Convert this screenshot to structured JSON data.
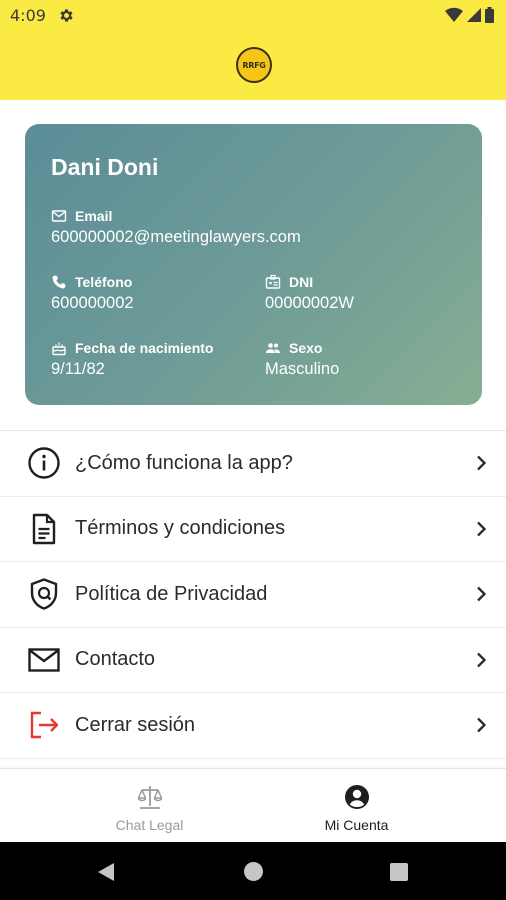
{
  "status_bar": {
    "time": "4:09"
  },
  "header": {
    "logo_text": "RRFG",
    "background_color": "#FBEA44"
  },
  "profile": {
    "name": "Dani Doni",
    "email_label": "Email",
    "email": "600000002@meetinglawyers.com",
    "phone_label": "Teléfono",
    "phone": "600000002",
    "dni_label": "DNI",
    "dni": "00000002W",
    "birth_label": "Fecha de nacimiento",
    "birth": "9/11/82",
    "sex_label": "Sexo",
    "sex": "Masculino"
  },
  "menu": [
    {
      "label": "¿Cómo funciona la app?",
      "icon": "info-icon"
    },
    {
      "label": "Términos y condiciones",
      "icon": "document-icon"
    },
    {
      "label": "Política de Privacidad",
      "icon": "shield-icon"
    },
    {
      "label": "Contacto",
      "icon": "mail-icon"
    },
    {
      "label": "Cerrar sesión",
      "icon": "logout-icon",
      "color": "#E53935"
    }
  ],
  "bottom_nav": {
    "tabs": [
      {
        "label": "Chat Legal",
        "icon": "scale-icon",
        "active": false
      },
      {
        "label": "Mi Cuenta",
        "icon": "account-circle-icon",
        "active": true
      }
    ]
  },
  "colors": {
    "card_gradient_start": "#5B8D98",
    "card_gradient_end": "#87AE92",
    "logout_red": "#E53935"
  }
}
